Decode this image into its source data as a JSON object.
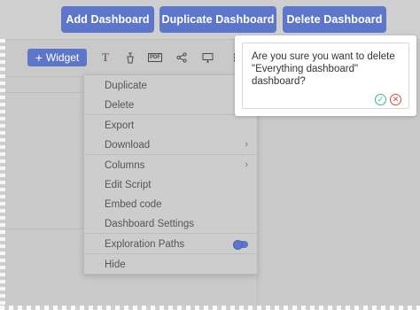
{
  "top_buttons": {
    "add": "Add Dashboard",
    "duplicate": "Duplicate Dashboard",
    "delete": "Delete Dashboard"
  },
  "toolbar": {
    "widget_label": "Widget",
    "icons": [
      "text-icon",
      "filter-icon",
      "pdf-icon",
      "share-icon",
      "monitor-icon",
      "more-icon"
    ]
  },
  "menu": {
    "items": [
      {
        "label": "Duplicate"
      },
      {
        "label": "Delete"
      },
      {
        "label": "Export"
      },
      {
        "label": "Download",
        "submenu": true
      },
      {
        "label": "Columns",
        "submenu": true
      },
      {
        "label": "Edit Script"
      },
      {
        "label": "Embed code"
      },
      {
        "label": "Dashboard Settings"
      },
      {
        "label": "Exploration Paths",
        "toggle": true,
        "toggle_on": true
      },
      {
        "label": "Hide"
      }
    ]
  },
  "popup": {
    "message": "Are you sure you want to delete \"Everything dashboard\" dashboard?",
    "confirm_icon": "check-icon",
    "cancel_icon": "close-icon"
  },
  "colors": {
    "accent": "#5e76c9",
    "confirm": "#3db3a0",
    "cancel": "#d04b4b"
  }
}
